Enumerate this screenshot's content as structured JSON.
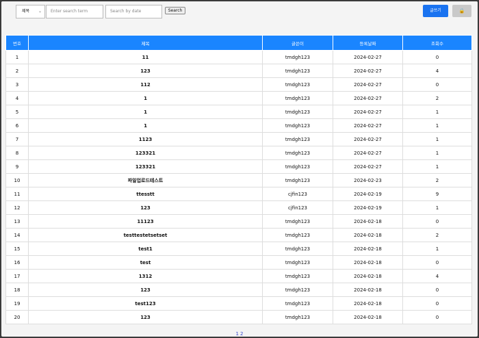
{
  "toolbar": {
    "select_value": "제목",
    "search_term_placeholder": "Enter search term",
    "search_date_placeholder": "Search by date",
    "search_label": "Search",
    "write_label": "글쓰기",
    "lock_label": "🔒"
  },
  "table": {
    "headers": [
      "번호",
      "제목",
      "글쓴이",
      "등록날짜",
      "조회수"
    ],
    "rows": [
      [
        "1",
        "11",
        "tmdgh123",
        "2024-02-27",
        "0"
      ],
      [
        "2",
        "123",
        "tmdgh123",
        "2024-02-27",
        "4"
      ],
      [
        "3",
        "112",
        "tmdgh123",
        "2024-02-27",
        "0"
      ],
      [
        "4",
        "1",
        "tmdgh123",
        "2024-02-27",
        "2"
      ],
      [
        "5",
        "1",
        "tmdgh123",
        "2024-02-27",
        "1"
      ],
      [
        "6",
        "1",
        "tmdgh123",
        "2024-02-27",
        "1"
      ],
      [
        "7",
        "1123",
        "tmdgh123",
        "2024-02-27",
        "1"
      ],
      [
        "8",
        "123321",
        "tmdgh123",
        "2024-02-27",
        "1"
      ],
      [
        "9",
        "123321",
        "tmdgh123",
        "2024-02-27",
        "1"
      ],
      [
        "10",
        "파일업로드테스트",
        "tmdgh123",
        "2024-02-23",
        "2"
      ],
      [
        "11",
        "ttesstt",
        "cjfin123",
        "2024-02-19",
        "9"
      ],
      [
        "12",
        "123",
        "cjfin123",
        "2024-02-19",
        "1"
      ],
      [
        "13",
        "11123",
        "tmdgh123",
        "2024-02-18",
        "0"
      ],
      [
        "14",
        "testtestetsetset",
        "tmdgh123",
        "2024-02-18",
        "2"
      ],
      [
        "15",
        "test1",
        "tmdgh123",
        "2024-02-18",
        "1"
      ],
      [
        "16",
        "test",
        "tmdgh123",
        "2024-02-18",
        "0"
      ],
      [
        "17",
        "1312",
        "tmdgh123",
        "2024-02-18",
        "4"
      ],
      [
        "18",
        "123",
        "tmdgh123",
        "2024-02-18",
        "0"
      ],
      [
        "19",
        "test123",
        "tmdgh123",
        "2024-02-18",
        "0"
      ],
      [
        "20",
        "123",
        "tmdgh123",
        "2024-02-18",
        "0"
      ]
    ]
  },
  "pager": {
    "pages": [
      "1",
      "2"
    ]
  }
}
